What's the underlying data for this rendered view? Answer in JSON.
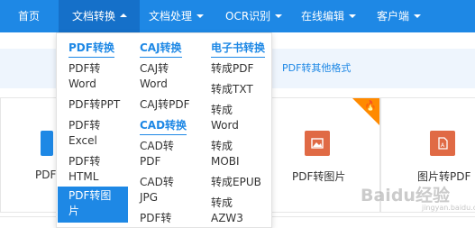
{
  "nav": {
    "items": [
      {
        "label": "首页"
      },
      {
        "label": "文档转换"
      },
      {
        "label": "文档处理"
      },
      {
        "label": "OCR识别"
      },
      {
        "label": "在线编辑"
      },
      {
        "label": "客户端"
      }
    ]
  },
  "banner": {
    "link": "PDF转其他格式"
  },
  "cards": [
    {
      "label": "PDF"
    },
    {
      "label": "PDF转图片",
      "icon": "image-icon"
    },
    {
      "label": "图片转PDF",
      "icon": "pdf-icon"
    }
  ],
  "dropdown": {
    "columns": [
      {
        "heading": "PDF转换",
        "items": [
          "PDF转\nWord",
          "PDF转PPT",
          "PDF转\nExcel",
          "PDF转\nHTML",
          "PDF转图\n片"
        ]
      },
      {
        "heading": "CAJ转换",
        "items": [
          "CAJ转\nWord",
          "CAJ转PDF"
        ],
        "heading2": "CAD转换",
        "items2": [
          "CAD转\nPDF",
          "CAD转\nJPG",
          "PDF转"
        ]
      },
      {
        "heading": "电子书转换",
        "items": [
          "转成PDF",
          "转成TXT",
          "转成\nWord",
          "转成\nMOBI",
          "转成EPUB",
          "转成\nAZW3"
        ]
      }
    ]
  },
  "watermark": {
    "text": "Baidu经验",
    "sub": "jingyan.baidu.com"
  },
  "colors": {
    "nav": "#1e88e5",
    "nav_active": "#1570c9",
    "accent": "#1e88e5",
    "card_icon": "#e06a45",
    "hot": "#ff8a00"
  }
}
